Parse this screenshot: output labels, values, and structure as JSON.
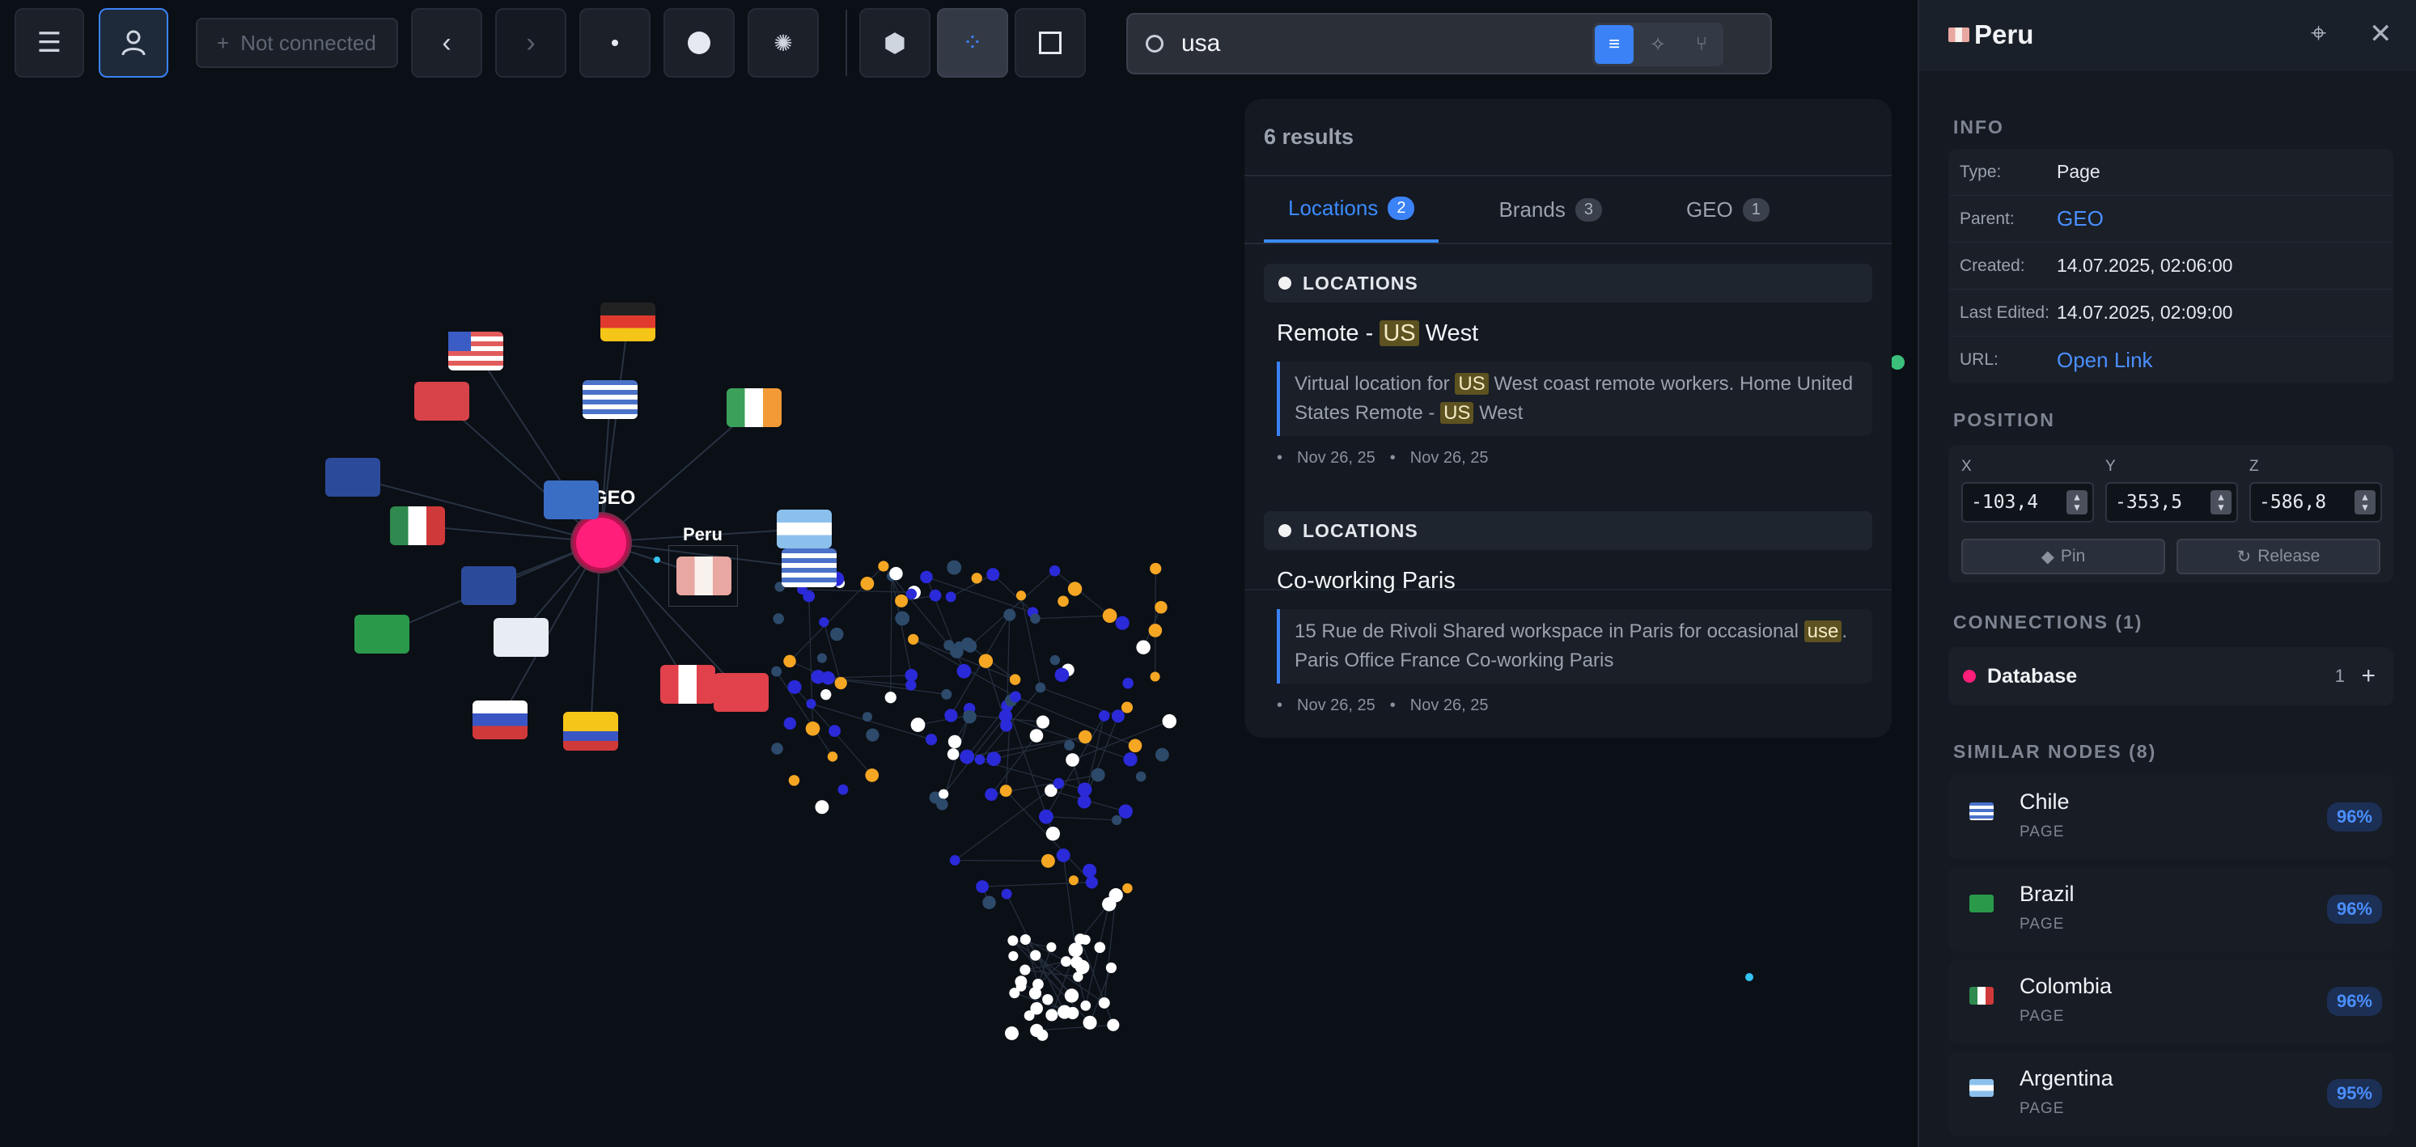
{
  "toolbar": {
    "not_connected_label": "Not connected",
    "search_value": "usa"
  },
  "graph": {
    "hub_label": "GEO",
    "selected_label": "Peru",
    "colors": {
      "hub": "#ff1f7a",
      "blue": "#2a2ad8",
      "orange": "#f5a623",
      "white": "#ffffff",
      "slate": "#2d4a6a"
    }
  },
  "results": {
    "count_label": "6 results",
    "tabs": [
      {
        "label": "Locations",
        "count": "2"
      },
      {
        "label": "Brands",
        "count": "3"
      },
      {
        "label": "GEO",
        "count": "1"
      }
    ],
    "items": [
      {
        "category": "LOCATIONS",
        "title_pre": "Remote - ",
        "title_hl": "US",
        "title_post": " West",
        "snippet_1": "Virtual location for ",
        "snippet_hl_1": "US",
        "snippet_2": " West coast remote workers. Home United States Remote - ",
        "snippet_hl_2": "US",
        "snippet_3": " West",
        "date_1": "Nov 26, 25",
        "date_2": "Nov 26, 25"
      },
      {
        "category": "LOCATIONS",
        "title": "Co-working Paris",
        "snippet_1": "15 Rue de Rivoli Shared workspace in Paris for occasional ",
        "snippet_hl_1": "use",
        "snippet_2": ". Paris Office France Co-working Paris",
        "date_1": "Nov 26, 25",
        "date_2": "Nov 26, 25"
      }
    ]
  },
  "panel": {
    "title": "Peru",
    "info_title": "INFO",
    "info": [
      {
        "key": "Type:",
        "value": "Page"
      },
      {
        "key": "Parent:",
        "value": "GEO"
      },
      {
        "key": "Created:",
        "value": "14.07.2025, 02:06:00"
      },
      {
        "key": "Last Edited:",
        "value": "14.07.2025, 02:09:00"
      },
      {
        "key": "URL:",
        "value": "Open Link"
      }
    ],
    "position_title": "POSITION",
    "position": {
      "x_label": "X",
      "y_label": "Y",
      "z_label": "Z",
      "x": "-103,4",
      "y": "-353,5",
      "z": "-586,8"
    },
    "pin_label": "Pin",
    "release_label": "Release",
    "connections_title": "CONNECTIONS (1)",
    "connection": {
      "name": "Database",
      "count": "1"
    },
    "similar_title": "SIMILAR NODES (8)",
    "similar": [
      {
        "name": "Chile",
        "type": "PAGE",
        "score": "96%"
      },
      {
        "name": "Brazil",
        "type": "PAGE",
        "score": "96%"
      },
      {
        "name": "Colombia",
        "type": "PAGE",
        "score": "96%"
      },
      {
        "name": "Argentina",
        "type": "PAGE",
        "score": "95%"
      }
    ]
  }
}
